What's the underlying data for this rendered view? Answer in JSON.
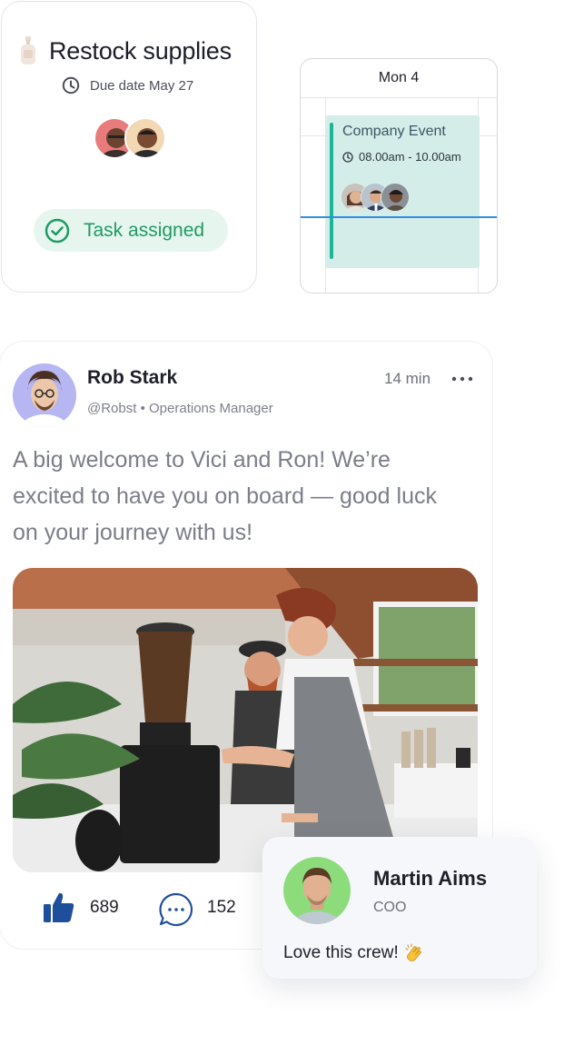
{
  "task_card": {
    "title": "Restock supplies",
    "due_label": "Due date May 27",
    "assignees": [
      {
        "icon": "avatar-man-1"
      },
      {
        "icon": "avatar-man-2"
      }
    ],
    "status_badge": "Task assigned",
    "status_color": "#1f9a63"
  },
  "calendar": {
    "day_label": "Mon 4",
    "event": {
      "title": "Company Event",
      "time": "08.00am - 10.00am",
      "color": "#d5ede8",
      "accent": "#1db59a",
      "attendees": [
        "avatar-woman",
        "avatar-man-3",
        "avatar-man-4"
      ]
    },
    "now_line_color": "#2f8fe0"
  },
  "post": {
    "author_name": "Rob Stark",
    "author_handle": "@Robst • Operations Manager",
    "time_ago": "14 min",
    "text": "A big welcome to Vici and Ron! We’re excited to have you on board — good luck on your journey with us!",
    "photo_icon": "cafe-baristas-photo",
    "likes": "689",
    "comments": "152"
  },
  "comment": {
    "author_name": "Martin Aims",
    "author_role": "COO",
    "text": "Love this crew!",
    "emoji_icon": "clapping-hands-icon"
  }
}
